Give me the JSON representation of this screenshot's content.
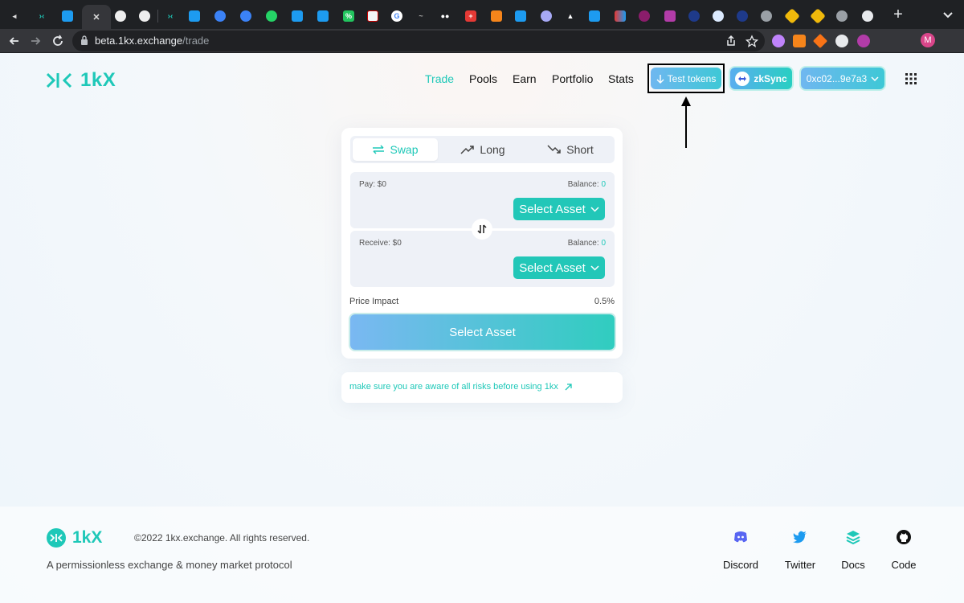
{
  "browser": {
    "url_host": "beta.1kx.exchange",
    "url_path": "/trade",
    "profile_initial": "M"
  },
  "header": {
    "logo_text": "1kX",
    "nav": [
      {
        "label": "Trade",
        "active": true
      },
      {
        "label": "Pools",
        "active": false
      },
      {
        "label": "Earn",
        "active": false
      },
      {
        "label": "Portfolio",
        "active": false
      },
      {
        "label": "Stats",
        "active": false
      }
    ],
    "test_tokens_label": "Test tokens",
    "network_label": "zkSync",
    "wallet_label": "0xc02...9e7a3"
  },
  "trade": {
    "tabs": [
      {
        "label": "Swap",
        "icon": "swap-arrows-icon",
        "selected": true
      },
      {
        "label": "Long",
        "icon": "trend-up-icon",
        "selected": false
      },
      {
        "label": "Short",
        "icon": "trend-down-icon",
        "selected": false
      }
    ],
    "pay": {
      "label": "Pay: $0",
      "balance_label": "Balance:",
      "balance_value": "0",
      "asset_button": "Select Asset"
    },
    "receive": {
      "label": "Receive: $0",
      "balance_label": "Balance:",
      "balance_value": "0",
      "asset_button": "Select Asset"
    },
    "price_impact_label": "Price Impact",
    "price_impact_value": "0.5%",
    "submit_label": "Select Asset"
  },
  "risk_notice": "make sure you are aware of all risks before using 1kx",
  "footer": {
    "logo_text": "1kX",
    "copyright": "©2022 1kx.exchange. All rights reserved.",
    "tagline": "A permissionless exchange & money market protocol",
    "links": [
      {
        "label": "Discord",
        "icon": "discord-icon"
      },
      {
        "label": "Twitter",
        "icon": "twitter-icon"
      },
      {
        "label": "Docs",
        "icon": "docs-stack-icon"
      },
      {
        "label": "Code",
        "icon": "github-icon"
      }
    ]
  },
  "colors": {
    "accent": "#1ec8b8",
    "chrome_dark": "#1f2124",
    "toolbar": "#35363a"
  }
}
